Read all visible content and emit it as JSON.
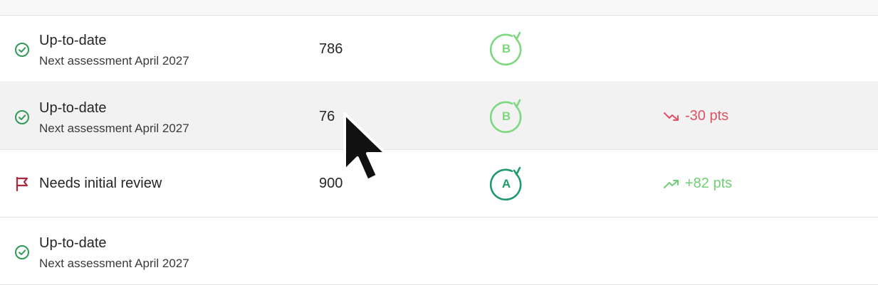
{
  "colors": {
    "check_green": "#2e9a56",
    "flag_red": "#b0243c",
    "grade_b": "#7dd87f",
    "grade_a": "#1f9a6a",
    "trend_down": "#e05262",
    "trend_up": "#6fcf76",
    "hover_row": "#f2f2f2"
  },
  "rows": [
    {
      "status_icon": "check-circle-icon",
      "status_title": "Up-to-date",
      "status_sub": "Next assessment April 2027",
      "score": "786",
      "grade": "B",
      "trend": ""
    },
    {
      "status_icon": "check-circle-icon",
      "status_title": "Up-to-date",
      "status_sub": "Next assessment April 2027",
      "score": "76",
      "grade": "B",
      "trend_icon": "trend-down-icon",
      "trend": "-30 pts"
    },
    {
      "status_icon": "flag-icon",
      "status_title": "Needs initial review",
      "score": "900",
      "grade": "A",
      "trend_icon": "trend-up-icon",
      "trend": "+82 pts"
    },
    {
      "status_icon": "check-circle-icon",
      "status_title": "Up-to-date",
      "status_sub": "Next assessment April 2027"
    }
  ]
}
